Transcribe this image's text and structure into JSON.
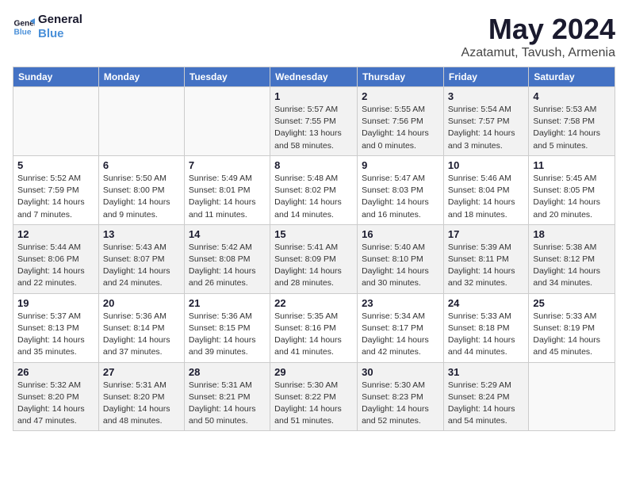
{
  "header": {
    "logo_line1": "General",
    "logo_line2": "Blue",
    "month_title": "May 2024",
    "subtitle": "Azatamut, Tavush, Armenia"
  },
  "weekdays": [
    "Sunday",
    "Monday",
    "Tuesday",
    "Wednesday",
    "Thursday",
    "Friday",
    "Saturday"
  ],
  "weeks": [
    [
      {
        "day": "",
        "info": ""
      },
      {
        "day": "",
        "info": ""
      },
      {
        "day": "",
        "info": ""
      },
      {
        "day": "1",
        "info": "Sunrise: 5:57 AM\nSunset: 7:55 PM\nDaylight: 13 hours\nand 58 minutes."
      },
      {
        "day": "2",
        "info": "Sunrise: 5:55 AM\nSunset: 7:56 PM\nDaylight: 14 hours\nand 0 minutes."
      },
      {
        "day": "3",
        "info": "Sunrise: 5:54 AM\nSunset: 7:57 PM\nDaylight: 14 hours\nand 3 minutes."
      },
      {
        "day": "4",
        "info": "Sunrise: 5:53 AM\nSunset: 7:58 PM\nDaylight: 14 hours\nand 5 minutes."
      }
    ],
    [
      {
        "day": "5",
        "info": "Sunrise: 5:52 AM\nSunset: 7:59 PM\nDaylight: 14 hours\nand 7 minutes."
      },
      {
        "day": "6",
        "info": "Sunrise: 5:50 AM\nSunset: 8:00 PM\nDaylight: 14 hours\nand 9 minutes."
      },
      {
        "day": "7",
        "info": "Sunrise: 5:49 AM\nSunset: 8:01 PM\nDaylight: 14 hours\nand 11 minutes."
      },
      {
        "day": "8",
        "info": "Sunrise: 5:48 AM\nSunset: 8:02 PM\nDaylight: 14 hours\nand 14 minutes."
      },
      {
        "day": "9",
        "info": "Sunrise: 5:47 AM\nSunset: 8:03 PM\nDaylight: 14 hours\nand 16 minutes."
      },
      {
        "day": "10",
        "info": "Sunrise: 5:46 AM\nSunset: 8:04 PM\nDaylight: 14 hours\nand 18 minutes."
      },
      {
        "day": "11",
        "info": "Sunrise: 5:45 AM\nSunset: 8:05 PM\nDaylight: 14 hours\nand 20 minutes."
      }
    ],
    [
      {
        "day": "12",
        "info": "Sunrise: 5:44 AM\nSunset: 8:06 PM\nDaylight: 14 hours\nand 22 minutes."
      },
      {
        "day": "13",
        "info": "Sunrise: 5:43 AM\nSunset: 8:07 PM\nDaylight: 14 hours\nand 24 minutes."
      },
      {
        "day": "14",
        "info": "Sunrise: 5:42 AM\nSunset: 8:08 PM\nDaylight: 14 hours\nand 26 minutes."
      },
      {
        "day": "15",
        "info": "Sunrise: 5:41 AM\nSunset: 8:09 PM\nDaylight: 14 hours\nand 28 minutes."
      },
      {
        "day": "16",
        "info": "Sunrise: 5:40 AM\nSunset: 8:10 PM\nDaylight: 14 hours\nand 30 minutes."
      },
      {
        "day": "17",
        "info": "Sunrise: 5:39 AM\nSunset: 8:11 PM\nDaylight: 14 hours\nand 32 minutes."
      },
      {
        "day": "18",
        "info": "Sunrise: 5:38 AM\nSunset: 8:12 PM\nDaylight: 14 hours\nand 34 minutes."
      }
    ],
    [
      {
        "day": "19",
        "info": "Sunrise: 5:37 AM\nSunset: 8:13 PM\nDaylight: 14 hours\nand 35 minutes."
      },
      {
        "day": "20",
        "info": "Sunrise: 5:36 AM\nSunset: 8:14 PM\nDaylight: 14 hours\nand 37 minutes."
      },
      {
        "day": "21",
        "info": "Sunrise: 5:36 AM\nSunset: 8:15 PM\nDaylight: 14 hours\nand 39 minutes."
      },
      {
        "day": "22",
        "info": "Sunrise: 5:35 AM\nSunset: 8:16 PM\nDaylight: 14 hours\nand 41 minutes."
      },
      {
        "day": "23",
        "info": "Sunrise: 5:34 AM\nSunset: 8:17 PM\nDaylight: 14 hours\nand 42 minutes."
      },
      {
        "day": "24",
        "info": "Sunrise: 5:33 AM\nSunset: 8:18 PM\nDaylight: 14 hours\nand 44 minutes."
      },
      {
        "day": "25",
        "info": "Sunrise: 5:33 AM\nSunset: 8:19 PM\nDaylight: 14 hours\nand 45 minutes."
      }
    ],
    [
      {
        "day": "26",
        "info": "Sunrise: 5:32 AM\nSunset: 8:20 PM\nDaylight: 14 hours\nand 47 minutes."
      },
      {
        "day": "27",
        "info": "Sunrise: 5:31 AM\nSunset: 8:20 PM\nDaylight: 14 hours\nand 48 minutes."
      },
      {
        "day": "28",
        "info": "Sunrise: 5:31 AM\nSunset: 8:21 PM\nDaylight: 14 hours\nand 50 minutes."
      },
      {
        "day": "29",
        "info": "Sunrise: 5:30 AM\nSunset: 8:22 PM\nDaylight: 14 hours\nand 51 minutes."
      },
      {
        "day": "30",
        "info": "Sunrise: 5:30 AM\nSunset: 8:23 PM\nDaylight: 14 hours\nand 52 minutes."
      },
      {
        "day": "31",
        "info": "Sunrise: 5:29 AM\nSunset: 8:24 PM\nDaylight: 14 hours\nand 54 minutes."
      },
      {
        "day": "",
        "info": ""
      }
    ]
  ]
}
